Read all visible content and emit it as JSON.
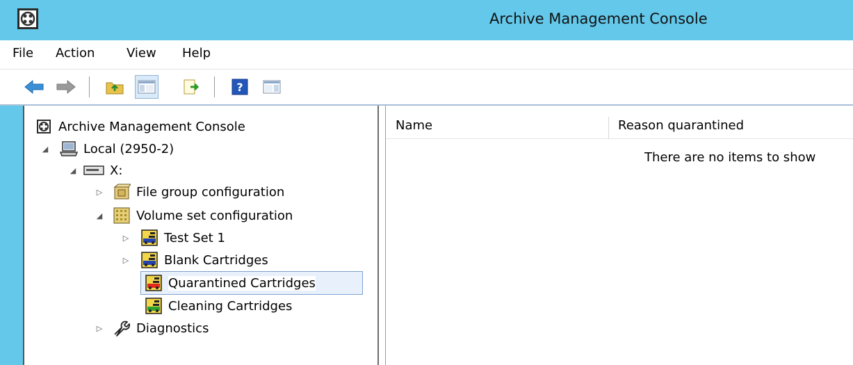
{
  "window": {
    "title": "Archive Management Console",
    "titlebar_color": "#63c8ea"
  },
  "menu": [
    {
      "label": "File"
    },
    {
      "label": "Action"
    },
    {
      "label": "View"
    },
    {
      "label": "Help"
    }
  ],
  "toolbar": {
    "buttons": [
      {
        "icon": "back-arrow-icon"
      },
      {
        "icon": "forward-arrow-icon"
      },
      {
        "icon": "up-folder-icon"
      },
      {
        "icon": "show-hide-tree-icon",
        "pressed": true
      },
      {
        "icon": "export-list-icon"
      },
      {
        "icon": "help-icon"
      },
      {
        "icon": "show-hide-action-pane-icon"
      }
    ]
  },
  "tree": {
    "root": {
      "label": "Archive Management Console",
      "icon": "console-icon"
    },
    "local": {
      "label": "Local (2950-2)",
      "icon": "computer-icon",
      "expanded": true
    },
    "drive": {
      "label": "X:",
      "icon": "drive-icon",
      "expanded": true
    },
    "file_group": {
      "label": "File group configuration",
      "icon": "file-group-icon",
      "expanded": false
    },
    "volume_set": {
      "label": "Volume set configuration",
      "icon": "volume-set-icon",
      "expanded": true
    },
    "test_set": {
      "label": "Test Set 1",
      "icon": "cartridge-set-icon",
      "expanded": false
    },
    "blank": {
      "label": "Blank Cartridges",
      "icon": "cartridge-set-icon",
      "expanded": false
    },
    "quarantined": {
      "label": "Quarantined Cartridges",
      "icon": "quarantined-cartridge-icon",
      "selected": true
    },
    "cleaning": {
      "label": "Cleaning Cartridges",
      "icon": "cleaning-cartridge-icon"
    },
    "diagnostics": {
      "label": "Diagnostics",
      "icon": "wrench-icon",
      "expanded": false
    }
  },
  "list": {
    "columns": [
      {
        "label": "Name"
      },
      {
        "label": "Reason quarantined"
      }
    ],
    "empty_message": "There are no items to show"
  }
}
